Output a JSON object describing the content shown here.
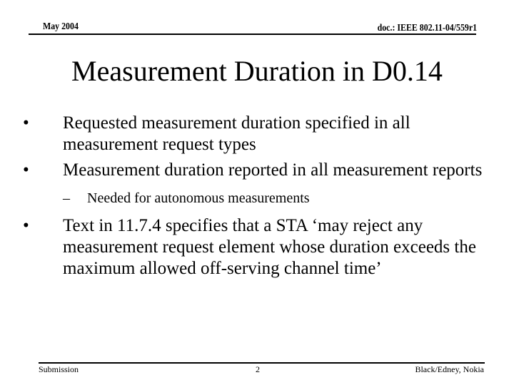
{
  "header": {
    "date": "May 2004",
    "doc_id": "doc.: IEEE 802.11-04/559r1"
  },
  "slide": {
    "title": "Measurement Duration in D0.14",
    "bullets": [
      {
        "text": "Requested measurement duration specified in all measurement request types"
      },
      {
        "text": "Measurement duration reported in all measurement reports",
        "sub": [
          "Needed for autonomous measurements"
        ]
      },
      {
        "text": "Text in 11.7.4 specifies that a STA ‘may reject any measurement request element whose duration exceeds the maximum allowed off-serving channel time’"
      }
    ],
    "bullet_glyph": "•",
    "sub_glyph": "–"
  },
  "footer": {
    "left": "Submission",
    "page_number": "2",
    "right": "Black/Edney, Nokia"
  }
}
